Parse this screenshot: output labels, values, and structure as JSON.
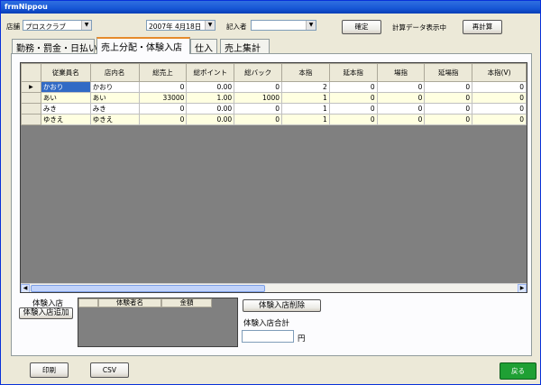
{
  "window": {
    "title": "frmNippou"
  },
  "header": {
    "store_label": "店舗",
    "store_value": "プロスクラブ",
    "date_value": "2007年  4月18日",
    "recorder_label": "記入者",
    "recorder_value": "",
    "confirm_label": "確定",
    "status_text": "計算データ表示中",
    "recalc_label": "再計算"
  },
  "tabs": [
    {
      "label": "勤務・罰金・日払い"
    },
    {
      "label": "売上分配・体験入店"
    },
    {
      "label": "仕入"
    },
    {
      "label": "売上集計"
    }
  ],
  "grid": {
    "columns": [
      "従業員名",
      "店内名",
      "総売上",
      "総ポイント",
      "総バック",
      "本指",
      "延本指",
      "場指",
      "延場指",
      "本指(V)"
    ],
    "rows": [
      {
        "marker": "▶",
        "cells": [
          "かおり",
          "かおり",
          "0",
          "0.00",
          "0",
          "2",
          "0",
          "0",
          "0",
          "0"
        ]
      },
      {
        "marker": "",
        "cells": [
          "あい",
          "あい",
          "33000",
          "1.00",
          "1000",
          "1",
          "0",
          "0",
          "0",
          "0"
        ]
      },
      {
        "marker": "",
        "cells": [
          "みき",
          "みき",
          "0",
          "0.00",
          "0",
          "1",
          "0",
          "0",
          "0",
          "0"
        ]
      },
      {
        "marker": "",
        "cells": [
          "ゆきえ",
          "ゆきえ",
          "0",
          "0.00",
          "0",
          "1",
          "0",
          "0",
          "0",
          "0"
        ]
      }
    ]
  },
  "trial": {
    "title": "体験入店",
    "add_label": "体験入店追加",
    "columns": [
      "体験者名",
      "金額"
    ],
    "delete_label": "体験入店削除",
    "total_label": "体験入店合計",
    "total_value": "",
    "yen_label": "円"
  },
  "footer": {
    "print_label": "印刷",
    "csv_label": "CSV",
    "back_label": "戻る"
  },
  "icons": {
    "dropdown": "chevron-down-icon",
    "scroll_left": "arrow-left-icon",
    "scroll_right": "arrow-right-icon"
  }
}
